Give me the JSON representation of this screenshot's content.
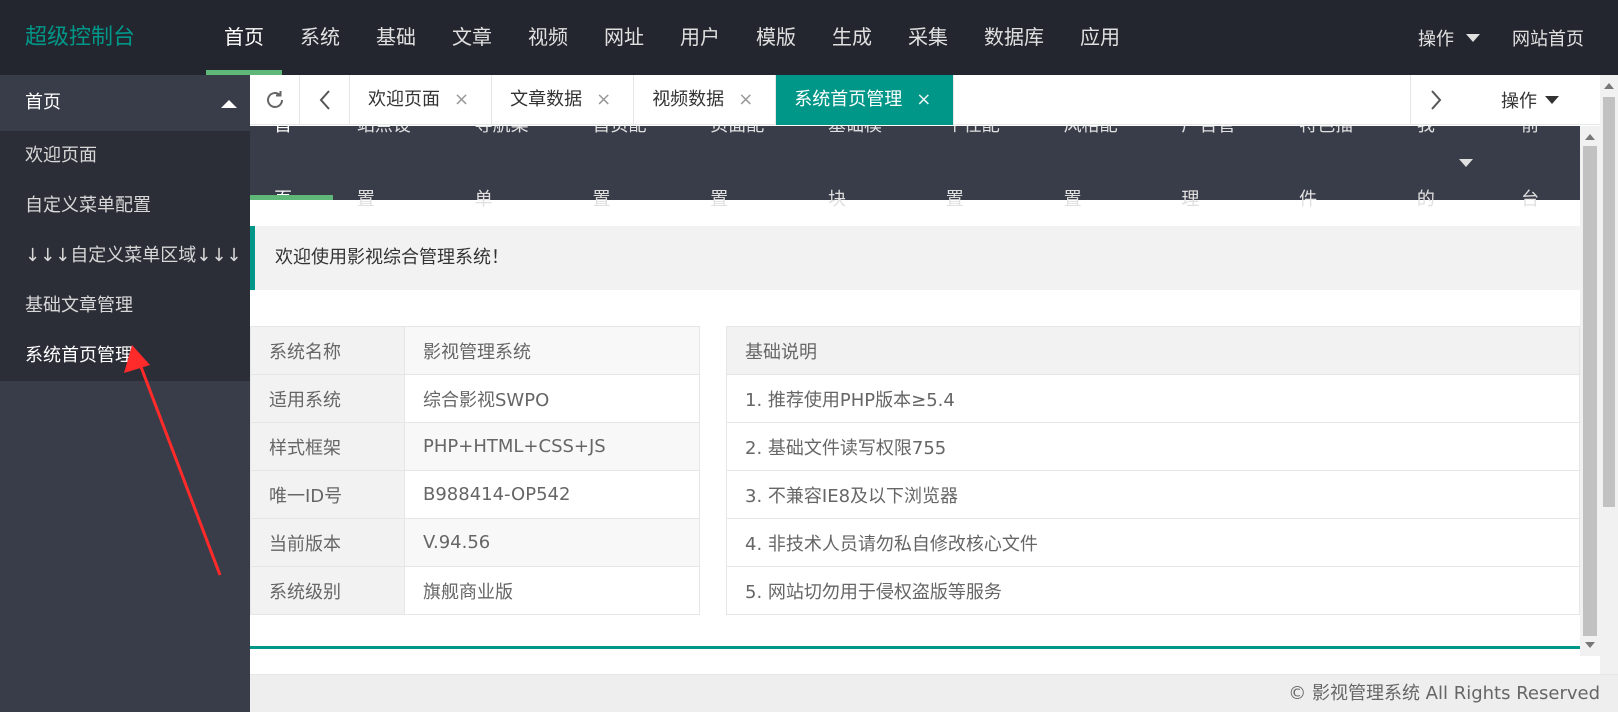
{
  "brand": "超级控制台",
  "top_nav": [
    "首页",
    "系统",
    "基础",
    "文章",
    "视频",
    "网址",
    "用户",
    "模版",
    "生成",
    "采集",
    "数据库",
    "应用"
  ],
  "top_right": {
    "ops_label": "操作",
    "home_label": "网站首页"
  },
  "sidebar": {
    "group_title": "首页",
    "items": [
      "欢迎页面",
      "自定义菜单配置",
      "↓↓↓自定义菜单区域↓↓↓",
      "基础文章管理",
      "系统首页管理"
    ]
  },
  "tabs": [
    {
      "label": "欢迎页面",
      "close": "×"
    },
    {
      "label": "文章数据",
      "close": "×"
    },
    {
      "label": "视频数据",
      "close": "×"
    },
    {
      "label": "系统首页管理",
      "close": "×"
    }
  ],
  "tab_ops_label": "操作",
  "subnav": [
    "首页",
    "站点设置",
    "导航菜单",
    "首页配置",
    "页面配置",
    "基础模块",
    "个性配置",
    "风格配置",
    "广告管理",
    "特色插件",
    "我的",
    "前台"
  ],
  "notice": "欢迎使用影视综合管理系统！",
  "info_rows": [
    {
      "k": "系统名称",
      "v": "影视管理系统"
    },
    {
      "k": "适用系统",
      "v": "综合影视SWPO"
    },
    {
      "k": "样式框架",
      "v": "PHP+HTML+CSS+JS"
    },
    {
      "k": "唯一ID号",
      "v": "B988414-OP542"
    },
    {
      "k": "当前版本",
      "v": "V.94.56"
    },
    {
      "k": "系统级别",
      "v": "旗舰商业版"
    }
  ],
  "notes": {
    "header": "基础说明",
    "rows": [
      "1. 推荐使用PHP版本≥5.4",
      "2. 基础文件读写权限755",
      "3. 不兼容IE8及以下浏览器",
      "4. 非技术人员请勿私自修改核心文件",
      "5. 网站切勿用于侵权盗版等服务"
    ]
  },
  "footer": "© 影视管理系统 All Rights Reserved",
  "colors": {
    "header_bg": "#23262e",
    "sidebar_bg": "#393d49",
    "accent": "#009688",
    "active_line": "#5fb878",
    "annotation": "#ff2a2a"
  },
  "icons": [
    "refresh-icon",
    "chevron-left-icon",
    "chevron-right-icon",
    "close-icon",
    "caret-down-icon",
    "caret-up-icon"
  ]
}
